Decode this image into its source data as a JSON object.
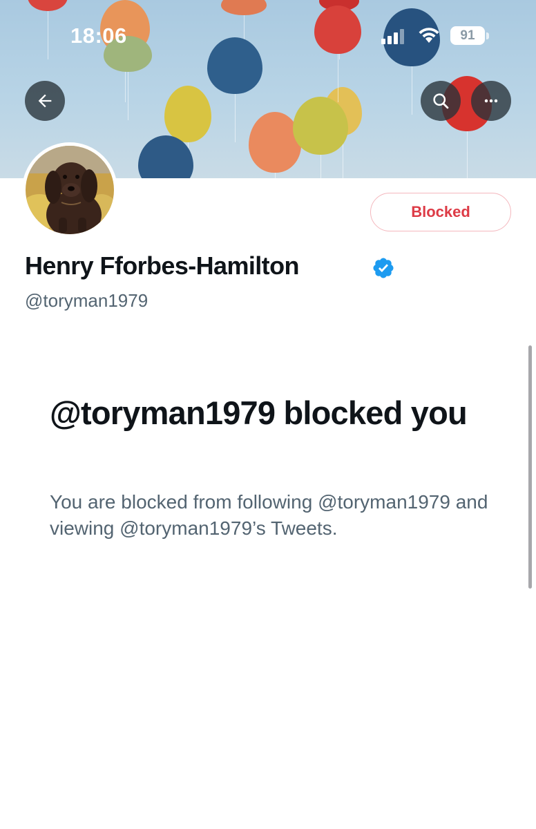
{
  "status_bar": {
    "time": "18:06",
    "battery": "91"
  },
  "header": {
    "back_icon": "arrow-left-icon",
    "search_icon": "search-icon",
    "more_icon": "more-horizontal-icon"
  },
  "profile": {
    "display_name": "Henry Fforbes-Hamilton",
    "handle": "@toryman1979",
    "verified_icon": "verified-badge-icon",
    "blocked_button_label": "Blocked"
  },
  "block_notice": {
    "heading": "@toryman1979 blocked you",
    "description": "You are blocked from following @toryman1979 and viewing @toryman1979’s Tweets."
  },
  "colors": {
    "blocked_red": "#dd3b46",
    "verified_blue": "#1d9bf0",
    "secondary_text": "#536471"
  }
}
